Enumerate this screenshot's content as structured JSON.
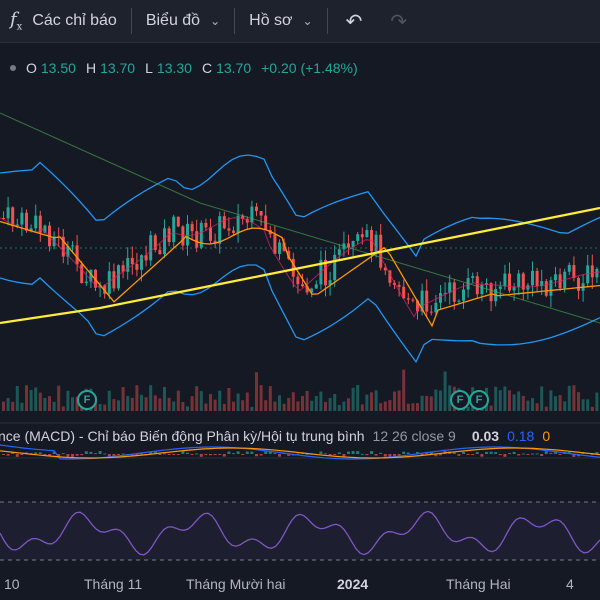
{
  "toolbar": {
    "indicators_label": "Các chỉ báo",
    "chart_label": "Biểu đồ",
    "profile_label": "Hồ sơ"
  },
  "ohlc": {
    "o_label": "O",
    "o_value": "13.50",
    "h_label": "H",
    "h_value": "13.70",
    "l_label": "L",
    "l_value": "13.30",
    "c_label": "C",
    "c_value": "13.70",
    "change": "+0.20 (+1.48%)"
  },
  "macd": {
    "title": "nce (MACD) - Chỉ báo Biến động Phân kỳ/Hội tụ trung bình",
    "params": "12 26 close 9",
    "value1": "0.03",
    "value2": "0.18",
    "value3": "0"
  },
  "badges": {
    "label": "F"
  },
  "xaxis": {
    "labels": [
      "10",
      "Tháng 11",
      "Tháng Mười hai",
      "2024",
      "Tháng Hai",
      "4"
    ]
  },
  "colors": {
    "up": "#26a69a",
    "down": "#ef5350",
    "bollinger": "#2196f3",
    "ma_long": "#ffeb3b",
    "ma_short": "#ff9800",
    "rsi": "#7e57c2"
  }
}
